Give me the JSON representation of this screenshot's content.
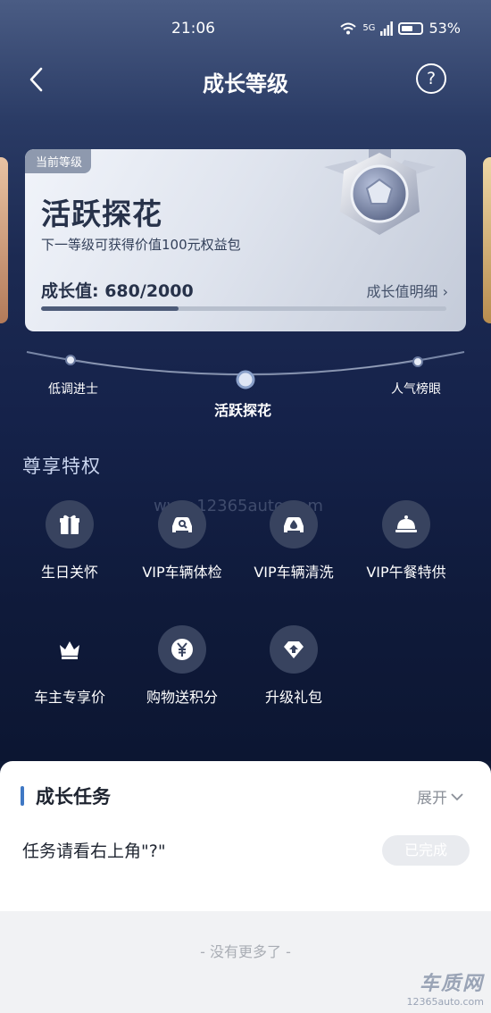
{
  "status_bar": {
    "time": "21:06",
    "signal": "5G",
    "battery": "53%"
  },
  "nav": {
    "title": "成长等级",
    "help": "?"
  },
  "card": {
    "tag": "当前等级",
    "title": "活跃探花",
    "subtitle": "下一等级可获得价值100元权益包",
    "growth_value": "成长值: 680/2000",
    "progress_fraction": 0.34,
    "detail_link": "成长值明细 ›"
  },
  "levels": [
    {
      "label": "低调进士"
    },
    {
      "label": "活跃探花"
    },
    {
      "label": "人气榜眼"
    }
  ],
  "privileges": {
    "title": "尊享特权",
    "items": [
      {
        "label": "生日关怀",
        "icon": "gift-icon"
      },
      {
        "label": "VIP车辆体检",
        "icon": "car-inspect-icon"
      },
      {
        "label": "VIP车辆清洗",
        "icon": "car-wash-icon"
      },
      {
        "label": "VIP午餐特供",
        "icon": "cloche-icon"
      },
      {
        "label": "车主专享价",
        "icon": "crown-icon"
      },
      {
        "label": "购物送积分",
        "icon": "yen-icon"
      },
      {
        "label": "升级礼包",
        "icon": "upgrade-icon"
      }
    ]
  },
  "watermark": "www.12365auto.com",
  "tasks": {
    "title": "成长任务",
    "expand": "展开",
    "task_text": "任务请看右上角\"?\"",
    "task_button": "已完成",
    "no_more": "- 没有更多了 -"
  },
  "logo": {
    "main": "车质网",
    "url": "12365auto.com"
  },
  "colors": {
    "accent": "#3f78c4",
    "dark_bg": "#15224a"
  }
}
